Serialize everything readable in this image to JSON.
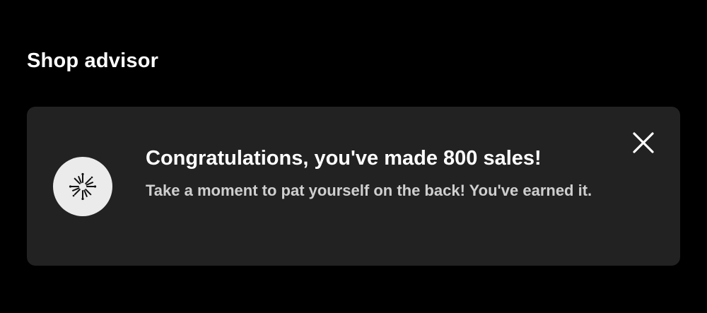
{
  "section": {
    "title": "Shop advisor"
  },
  "notification": {
    "icon": "fireworks-icon",
    "headline": "Congratulations, you've made 800 sales!",
    "body": "Take a moment to pat yourself on the back! You've earned it.",
    "close_icon": "close-icon"
  },
  "colors": {
    "background": "#000000",
    "card_background": "#222222",
    "icon_circle": "#ebebeb",
    "headline_text": "#ffffff",
    "body_text": "#cfcfcf"
  }
}
